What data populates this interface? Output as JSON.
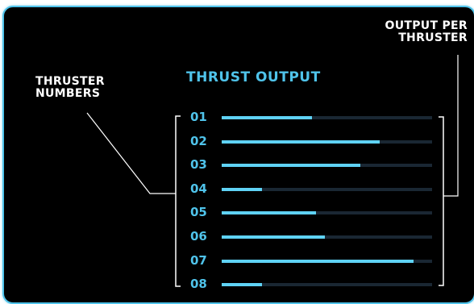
{
  "title": "THRUST OUTPUT",
  "callout_left": [
    "THRUSTER",
    "NUMBERS"
  ],
  "callout_right": [
    "OUTPUT PER",
    "THRUSTER"
  ],
  "accent_color": "#4fc3ea",
  "thrusters": [
    {
      "number": "01",
      "output": 0.43
    },
    {
      "number": "02",
      "output": 0.75
    },
    {
      "number": "03",
      "output": 0.66
    },
    {
      "number": "04",
      "output": 0.19
    },
    {
      "number": "05",
      "output": 0.45
    },
    {
      "number": "06",
      "output": 0.49
    },
    {
      "number": "07",
      "output": 0.91
    },
    {
      "number": "08",
      "output": 0.19
    }
  ]
}
